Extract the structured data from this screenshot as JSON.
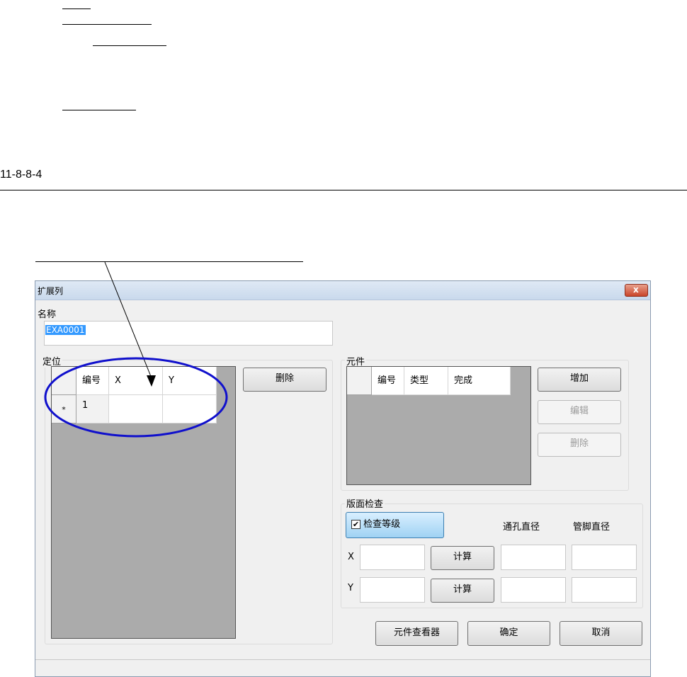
{
  "document": {
    "section_number": "11-8-8-4"
  },
  "dialog": {
    "title": "扩展列",
    "close_glyph": "x",
    "name_label": "名称",
    "name_value": "EXA0001",
    "positioning": {
      "label": "定位",
      "columns": [
        "编号",
        "X",
        "Y"
      ],
      "rows": [
        {
          "marker": "*",
          "number": "1",
          "x": "",
          "y": ""
        }
      ],
      "delete_button": "删除"
    },
    "components": {
      "label": "元件",
      "columns": [
        "编号",
        "类型",
        "完成"
      ],
      "add_button": "增加",
      "edit_button": "编辑",
      "delete_button": "删除"
    },
    "board_check": {
      "label": "版面检查",
      "check_level_label": "检查等级",
      "check_level_checked": true,
      "checkmark": "✔",
      "via_diameter_label": "通孔直径",
      "pin_diameter_label": "管脚直径",
      "x_label": "X",
      "y_label": "Y",
      "calc_button_x": "计算",
      "calc_button_y": "计算"
    },
    "footer": {
      "viewer_button": "元件查看器",
      "ok_button": "确定",
      "cancel_button": "取消"
    }
  },
  "colors": {
    "annotation_ellipse": "#1010cc",
    "grid_background": "#ababab",
    "selection": "#3399ff"
  }
}
